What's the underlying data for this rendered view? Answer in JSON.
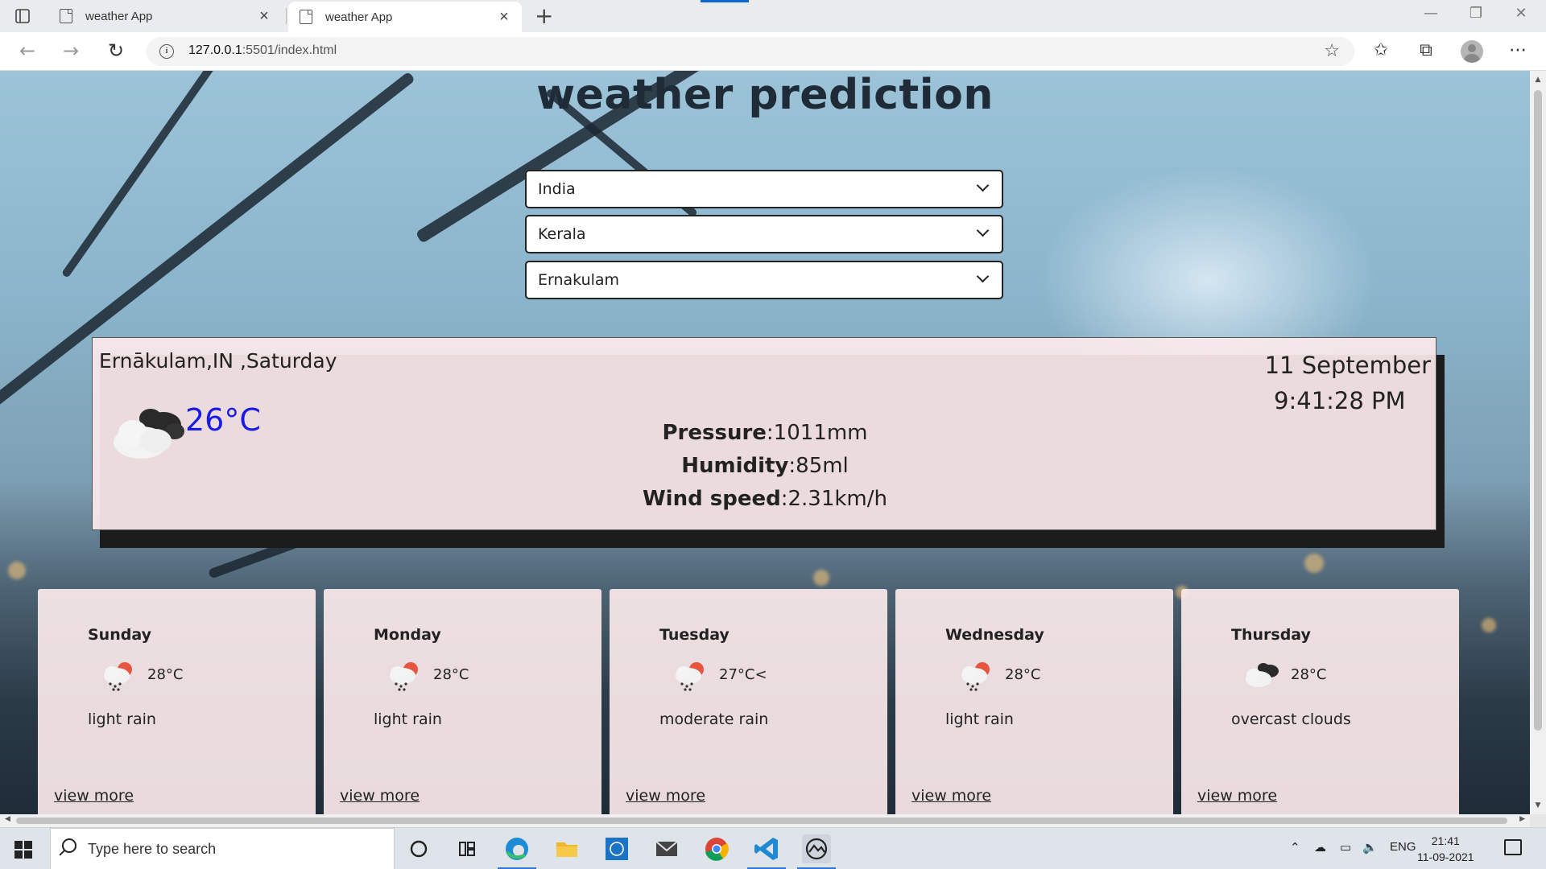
{
  "browser": {
    "tabs": [
      {
        "label": "weather App"
      },
      {
        "label": "weather App"
      }
    ],
    "url_host": "127.0.0.1",
    "url_path": ":5501/index.html"
  },
  "page": {
    "title": "weather prediction",
    "selects": {
      "country": "India",
      "state": "Kerala",
      "city": "Ernakulam"
    },
    "current": {
      "location": "Ernākulam,IN ,Saturday",
      "date": "11 September",
      "time": "9:41:28 PM",
      "temp": "26°C",
      "icon": "overcast-clouds-icon",
      "pressure_label": "Pressure",
      "pressure_value": ":1011mm",
      "humidity_label": "Humidity",
      "humidity_value": ":85ml",
      "wind_label": "Wind speed",
      "wind_value": ":2.31km/h"
    },
    "forecast": [
      {
        "day": "Sunday",
        "temp": "28°C",
        "desc": "light rain",
        "icon": "light-rain-icon",
        "more": "view more"
      },
      {
        "day": "Monday",
        "temp": "28°C",
        "desc": "light rain",
        "icon": "light-rain-icon",
        "more": "view more"
      },
      {
        "day": "Tuesday",
        "temp": "27°C<",
        "desc": "moderate rain",
        "icon": "moderate-rain-icon",
        "more": "view more"
      },
      {
        "day": "Wednesday",
        "temp": "28°C",
        "desc": "light rain",
        "icon": "light-rain-icon",
        "more": "view more"
      },
      {
        "day": "Thursday",
        "temp": "28°C",
        "desc": "overcast clouds",
        "icon": "overcast-clouds-icon",
        "more": "view more"
      }
    ]
  },
  "taskbar": {
    "search_placeholder": "Type here to search",
    "lang": "ENG",
    "time": "21:41",
    "date": "11-09-2021"
  },
  "colors": {
    "temp_accent": "#1a1ae6",
    "card_bg": "#fbeaec"
  }
}
